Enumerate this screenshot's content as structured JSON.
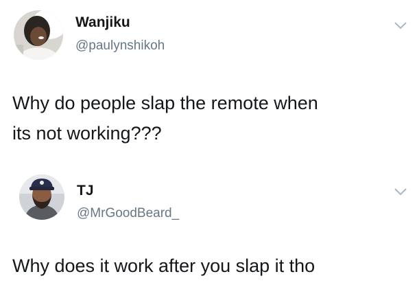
{
  "tweets": [
    {
      "display_name": "Wanjiku",
      "handle": "@paulynshikoh",
      "text_lines": [
        "Why do people slap the remote when",
        "its not working???"
      ],
      "avatar_icon": "profile-photo-woman",
      "menu_icon": "chevron-down-icon"
    },
    {
      "display_name": "TJ",
      "handle": "@MrGoodBeard_",
      "text_lines": [
        "Why does it work after you slap it tho"
      ],
      "avatar_icon": "profile-photo-bearded-man",
      "menu_icon": "chevron-down-icon"
    }
  ],
  "colors": {
    "text": "#14171a",
    "handle": "#657786",
    "chevron": "#aab8c2",
    "background": "#ffffff"
  }
}
